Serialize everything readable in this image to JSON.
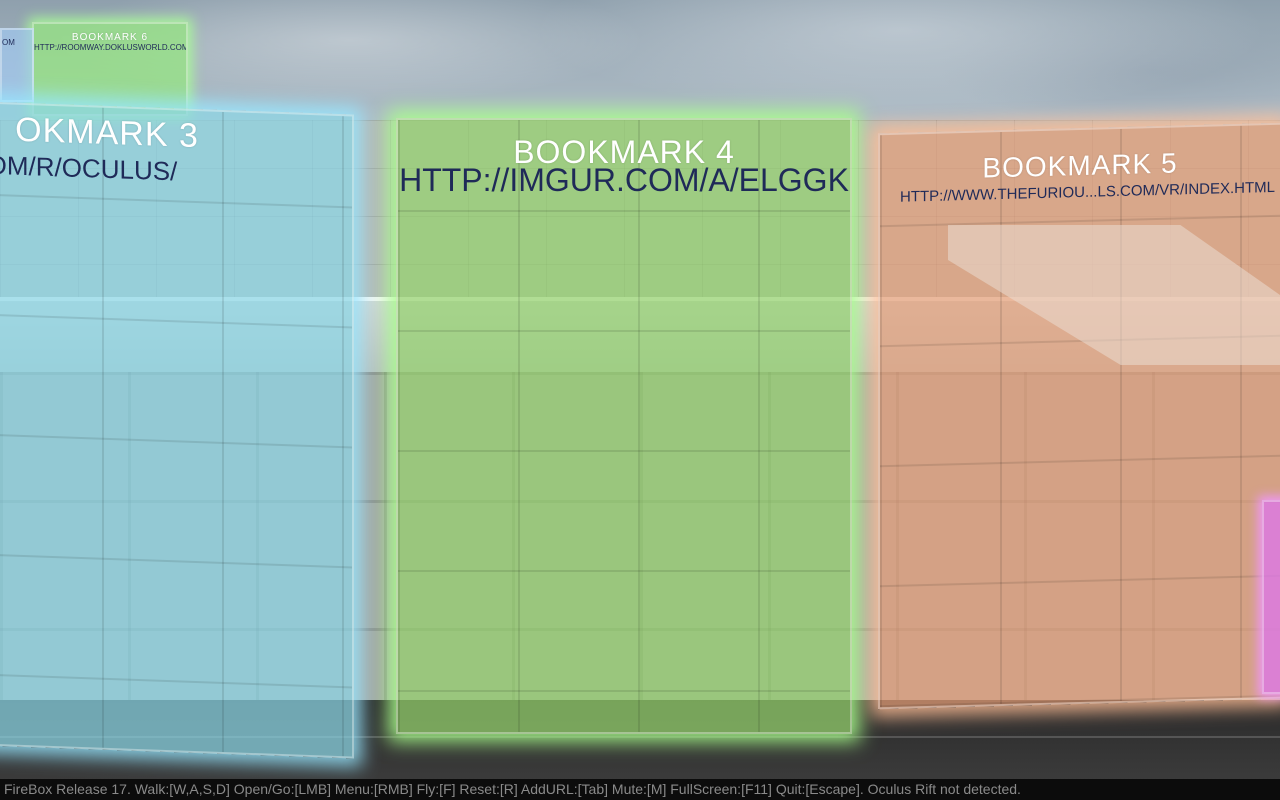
{
  "scene": {
    "colors": {
      "sky": "#b7c3ca",
      "floor": "#2e2e2e",
      "bookmark_3": "#8cd7e6",
      "bookmark_4": "#96d26e",
      "bookmark_5": "#e6a078",
      "bookmark_6": "#96e682",
      "edge_panel": "#dc78e6"
    }
  },
  "bookmarks": [
    {
      "title": "BOOKMARK  6",
      "url": "HTTP://ROOMWAY.DOKLUSWORLD.COM/"
    },
    {
      "title": "",
      "url": "OM"
    },
    {
      "title": "OKMARK  3",
      "url": "REDDIT.COM/R/OCULUS/"
    },
    {
      "title": "BOOKMARK  4",
      "url": "HTTP://IMGUR.COM/A/ELGGK"
    },
    {
      "title": "BOOKMARK  5",
      "url": "HTTP://WWW.THEFURIOU...LS.COM/VR/INDEX.HTML"
    }
  ],
  "status_bar": {
    "text": "FireBox Release 17. Walk:[W,A,S,D] Open/Go:[LMB] Menu:[RMB] Fly:[F] Reset:[R] AddURL:[Tab] Mute:[M] FullScreen:[F11] Quit:[Escape].  Oculus Rift not detected."
  }
}
